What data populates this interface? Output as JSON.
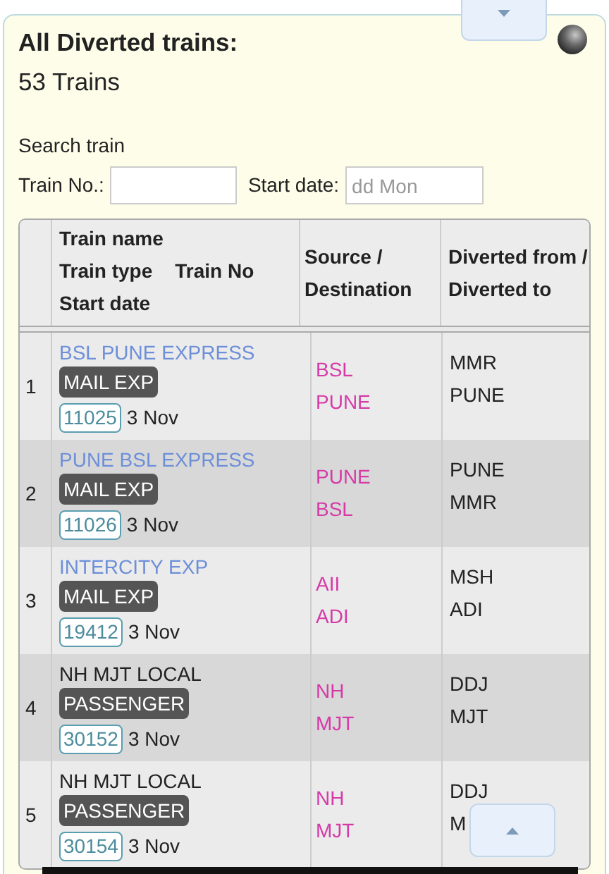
{
  "title": "All Diverted trains:",
  "count": "53 Trains",
  "search": {
    "heading": "Search train",
    "train_no_label": "Train No.:",
    "start_date_label": "Start date:",
    "start_date_placeholder": "dd Mon"
  },
  "table": {
    "name_header": [
      "Train name",
      "Train type",
      "Train No",
      "Start date"
    ],
    "route_header": "Source / Destination",
    "diversion_header": "Diverted from / Diverted to",
    "rows": [
      {
        "index": "1",
        "name": "BSL PUNE EXPRESS",
        "color": "#6d8fd8",
        "type": "MAIL EXP",
        "number": "11025",
        "date": "3 Nov",
        "source": "BSL",
        "destination": "PUNE",
        "diverted_from": "MMR",
        "diverted_to": "PUNE"
      },
      {
        "index": "2",
        "name": "PUNE BSL EXPRESS",
        "color": "#6d8fd8",
        "type": "MAIL EXP",
        "number": "11026",
        "date": "3 Nov",
        "source": "PUNE",
        "destination": "BSL",
        "diverted_from": "PUNE",
        "diverted_to": "MMR"
      },
      {
        "index": "3",
        "name": "INTERCITY EXP",
        "color": "#6d8fd8",
        "type": "MAIL EXP",
        "number": "19412",
        "date": "3 Nov",
        "source": "AII",
        "destination": "ADI",
        "diverted_from": "MSH",
        "diverted_to": "ADI"
      },
      {
        "index": "4",
        "name": "NH MJT LOCAL",
        "color": "#222222",
        "type": "PASSENGER",
        "number": "30152",
        "date": "3 Nov",
        "source": "NH",
        "destination": "MJT",
        "diverted_from": "DDJ",
        "diverted_to": "MJT"
      },
      {
        "index": "5",
        "name": "NH MJT LOCAL",
        "color": "#222222",
        "type": "PASSENGER",
        "number": "30154",
        "date": "3 Nov",
        "source": "NH",
        "destination": "MJT",
        "diverted_from": "DDJ",
        "diverted_to": "M"
      }
    ]
  }
}
